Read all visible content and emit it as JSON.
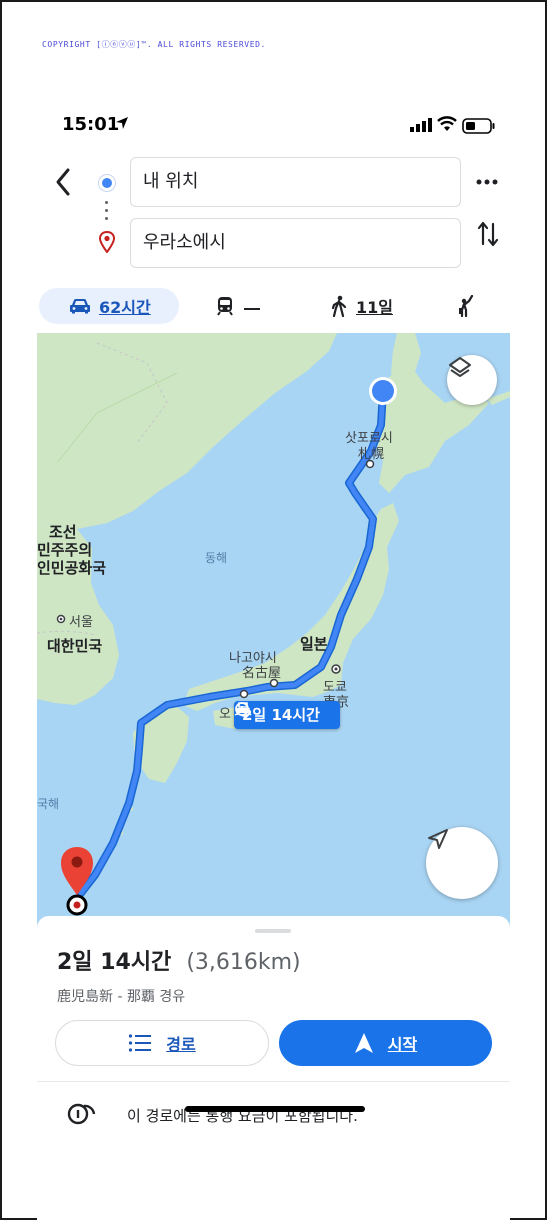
{
  "copyright": "COPYRIGHT [ⓘⓝⓥⓤ]™. ALL RIGHTS RESERVED.",
  "status_bar": {
    "time": "15:01"
  },
  "directions": {
    "origin": "내 위치",
    "destination": "우라소에시"
  },
  "travel_modes": {
    "car": "62시간",
    "walk": "11일"
  },
  "map": {
    "labels": {
      "sapporo_ko": "삿포로시",
      "sapporo_ja": "札幌",
      "dprk_1": "조선",
      "dprk_2": "민주주의",
      "dprk_3": "인민공화국",
      "east_sea": "동해",
      "seoul": "서울",
      "korea": "대한민국",
      "nagoya_ko": "나고야시",
      "nagoya_ja": "名古屋",
      "japan": "일본",
      "tokyo_ko": "도쿄",
      "tokyo_ja": "東京",
      "osaka_partial": "오",
      "south_sea_partial": "국해"
    },
    "route_callout": "2일 14시간",
    "route_color": "#4285f4"
  },
  "route_sheet": {
    "duration": "2일 14시간",
    "distance": "(3,616km)",
    "via": "鹿児島新 - 那覇 경유",
    "steps_label": "경로",
    "start_label": "시작",
    "toll_notice": "이 경로에는 통행 요금이 포함됩니다."
  },
  "colors": {
    "accent": "#1a73e8",
    "water": "#a9d5f4",
    "land": "#cfe6c4"
  }
}
